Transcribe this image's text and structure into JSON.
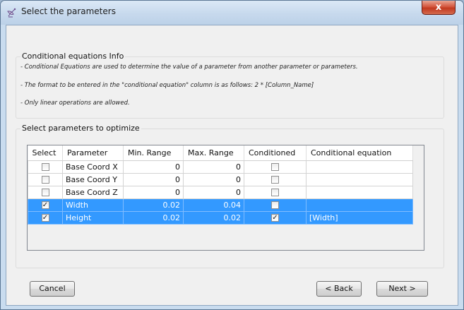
{
  "window": {
    "title": "Select the parameters",
    "close_label": "x",
    "title_icon": "satellite-dish-icon"
  },
  "info_group": {
    "legend": "Conditional equations Info",
    "lines": [
      "- Conditional Equations are used to determine the value of a parameter from another parameter or parameters.",
      "- The format to be entered in the \"conditional equation\" column is as follows:    2 * [Column_Name]",
      "- Only linear operations are allowed."
    ]
  },
  "params_group": {
    "legend": "Select parameters to optimize"
  },
  "table": {
    "columns": [
      "Select",
      "Parameter",
      "Min. Range",
      "Max. Range",
      "Conditioned",
      "Conditional equation"
    ],
    "rows": [
      {
        "select": false,
        "parameter": "Base Coord X",
        "min": "0",
        "max": "0",
        "conditioned": false,
        "equation": "",
        "highlighted": false
      },
      {
        "select": false,
        "parameter": "Base Coord Y",
        "min": "0",
        "max": "0",
        "conditioned": false,
        "equation": "",
        "highlighted": false
      },
      {
        "select": false,
        "parameter": "Base Coord Z",
        "min": "0",
        "max": "0",
        "conditioned": false,
        "equation": "",
        "highlighted": false
      },
      {
        "select": true,
        "parameter": "Width",
        "min": "0.02",
        "max": "0.04",
        "conditioned": false,
        "equation": "",
        "highlighted": true
      },
      {
        "select": true,
        "parameter": "Height",
        "min": "0.02",
        "max": "0.02",
        "conditioned": true,
        "equation": "[Width]",
        "highlighted": true
      }
    ],
    "highlight_color": "#3399ff"
  },
  "buttons": {
    "cancel": "Cancel",
    "back": "< Back",
    "next": "Next >"
  },
  "colors": {
    "titlebar": "#c7d9ed",
    "close": "#c2391f",
    "client_bg": "#f0f0f0"
  }
}
